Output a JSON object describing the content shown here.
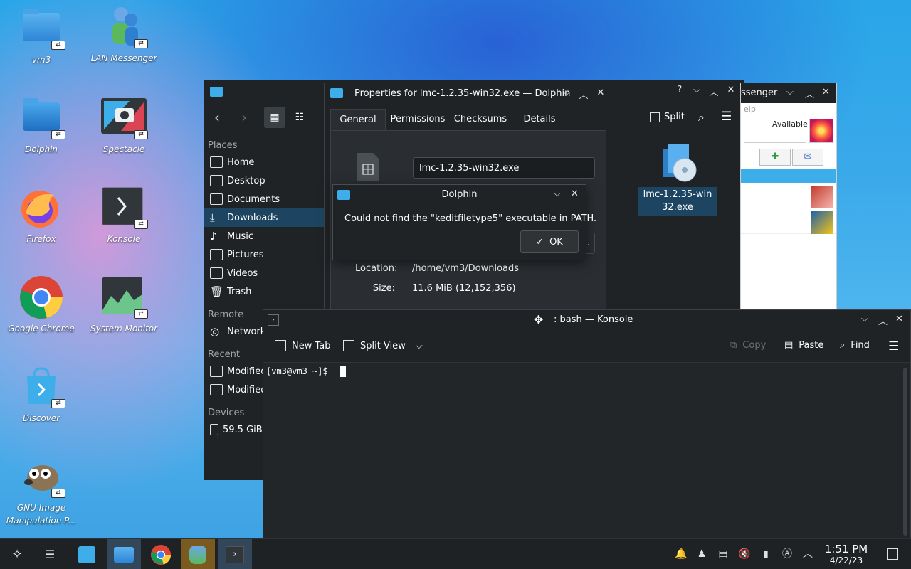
{
  "desktop": {
    "icons": [
      {
        "label": "vm3"
      },
      {
        "label": "LAN Messenger"
      },
      {
        "label": "Dolphin"
      },
      {
        "label": "Spectacle"
      },
      {
        "label": "Firefox"
      },
      {
        "label": "Konsole"
      },
      {
        "label": "Google Chrome"
      },
      {
        "label": "System Monitor"
      },
      {
        "label": "Discover"
      },
      {
        "label": "GNU Image Manipulation P..."
      }
    ]
  },
  "dolphin": {
    "toolbar": {
      "split_label": "Split"
    },
    "places": {
      "header_places": "Places",
      "items": [
        "Home",
        "Desktop",
        "Documents",
        "Downloads",
        "Music",
        "Pictures",
        "Videos",
        "Trash"
      ],
      "header_remote": "Remote",
      "remote_items": [
        "Network"
      ],
      "header_recent": "Recent",
      "recent_items": [
        "Modified",
        "Modified"
      ],
      "header_devices": "Devices",
      "device_items": [
        "59.5 GiB"
      ]
    },
    "file": {
      "name": "lmc-1.2.35-win32.exe"
    }
  },
  "messenger": {
    "title_fragment": "ssenger",
    "menu_fragment": "elp",
    "status": "Available"
  },
  "properties": {
    "title": "Properties for lmc-1.2.35-win32.exe — Dolphin",
    "tabs": [
      "General",
      "Permissions",
      "Checksums",
      "Details"
    ],
    "name_value": "lmc-1.2.35-win32.exe",
    "location_label": "Location:",
    "location_value": "/home/vm3/Downloads",
    "size_label": "Size:",
    "size_value": "11.6 MiB (12,152,356)"
  },
  "error_dialog": {
    "title": "Dolphin",
    "message": "Could not find the \"keditfiletype5\" executable in PATH.",
    "ok_label": "OK"
  },
  "konsole": {
    "title": ": bash — Konsole",
    "toolbar": {
      "new_tab": "New Tab",
      "split_view": "Split View",
      "copy": "Copy",
      "paste": "Paste",
      "find": "Find"
    },
    "prompt": "[vm3@vm3 ~]$ "
  },
  "taskbar": {
    "time": "1:51 PM",
    "date": "4/22/23"
  },
  "colors": {
    "accent": "#3daee9",
    "selection": "#1d4561",
    "window_bg": "#202326"
  }
}
